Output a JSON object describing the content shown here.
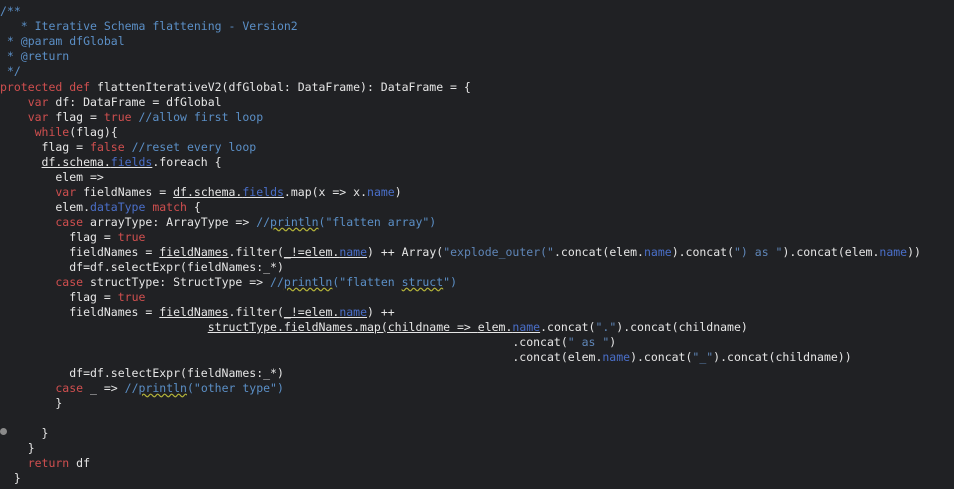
{
  "colors": {
    "background": "#202124",
    "text": "#e6e6e6",
    "keyword": "#cf4f4f",
    "comment": "#5b8fc6",
    "string": "#5f86b8",
    "field": "#4a6fc9"
  },
  "code": {
    "l1": "/**",
    "l2": "   * Iterative Schema flattening - Version2",
    "l3": " * @param dfGlobal",
    "l4": " * @return",
    "l5": " */",
    "l6_kw": "protected def ",
    "l6_rest": "flattenIterativeV2(dfGlobal: DataFrame): DataFrame = {",
    "l7_kw": "    var ",
    "l7_rest": "df: DataFrame = dfGlobal",
    "l8_kw": "    var ",
    "l8_a": "flag",
    "l8_b": " = ",
    "l8_kw2": "true",
    "l8_cm": " //allow first loop",
    "l9_kw": "     while",
    "l9_a": "(",
    "l9_b": "flag",
    "l9_c": "){",
    "l10_a": "      flag",
    "l10_b": " = ",
    "l10_kw": "false",
    "l10_cm": " //reset every loop",
    "l11_sp": "      ",
    "l11_a": "df.schema.",
    "l11_fld": "fields",
    "l11_b": ".foreach {",
    "l12": "        elem =>",
    "l13_kw": "        var ",
    "l13_a": "fieldNames",
    "l13_b": " = ",
    "l13_c": "df.schema.",
    "l13_fld": "fields",
    "l13_d": ".map(x => x.",
    "l13_fld2": "name",
    "l13_e": ")",
    "l14_a": "        elem.",
    "l14_fld": "dataType",
    "l14_kw": " match",
    "l14_b": " {",
    "l15_kw": "        case ",
    "l15_a": "arrayType: ArrayType => ",
    "l15_cm1": "//",
    "l15_sq": "println",
    "l15_cm2": "(\"flatten array\")",
    "l16_a": "          flag",
    "l16_b": " = ",
    "l16_kw": "true",
    "l17_sp": "          ",
    "l17_a": "fieldNames",
    "l17_b": " = ",
    "l17_c": "fieldNames",
    "l17_d": ".filter(",
    "l17_e": "_!=elem.",
    "l17_fld": "name",
    "l17_f": ") ++ Array(",
    "l17_str1": "\"explode_outer(\"",
    "l17_g": ".concat(elem.",
    "l17_fld2": "name",
    "l17_h": ").concat(",
    "l17_str2": "\") as \"",
    "l17_i": ").concat(elem.",
    "l17_fld3": "name",
    "l17_j": "))",
    "l18_a": "          df=df.selectExpr(",
    "l18_b": "fieldNames",
    "l18_c": ":_*)",
    "l19_kw": "        case ",
    "l19_a": "structType: StructType => ",
    "l19_cm1": "//",
    "l19_sq": "println",
    "l19_cm2": "(\"flatten ",
    "l19_sq2": "struct",
    "l19_cm3": "\")",
    "l20_a": "          flag",
    "l20_b": " = ",
    "l20_kw": "true",
    "l21_sp": "          ",
    "l21_a": "fieldNames",
    "l21_b": " = ",
    "l21_c": "fieldNames",
    "l21_d": ".filter(",
    "l21_e": "_!=elem.",
    "l21_fld": "name",
    "l21_f": ") ++",
    "l22_sp": "                              ",
    "l22_a": "structType",
    "l22_b": ".fieldNames.map(childname => ",
    "l22_c": "elem.",
    "l22_fld": "name",
    "l22_d": ".concat(",
    "l22_str": "\".\"",
    "l22_e": ").concat(childname)",
    "l23_sp": "                                                                          ",
    "l23_a": ".concat(",
    "l23_str": "\" as \"",
    "l23_b": ")",
    "l24_sp": "                                                                          ",
    "l24_a": ".concat(elem.",
    "l24_fld": "name",
    "l24_b": ").concat(",
    "l24_str": "\"_\"",
    "l24_c": ").concat(childname))",
    "l25_a": "          df=df.selectExpr(",
    "l25_b": "fieldNames",
    "l25_c": ":_*)",
    "l26_kw": "        case ",
    "l26_a": "_ => ",
    "l26_cm1": "//",
    "l26_sq": "println",
    "l26_cm2": "(\"other type\")",
    "l27": "        }",
    "l29": "      }",
    "l30": "    }",
    "l31_kw": "    return ",
    "l31_a": "df",
    "l32": "  }"
  }
}
